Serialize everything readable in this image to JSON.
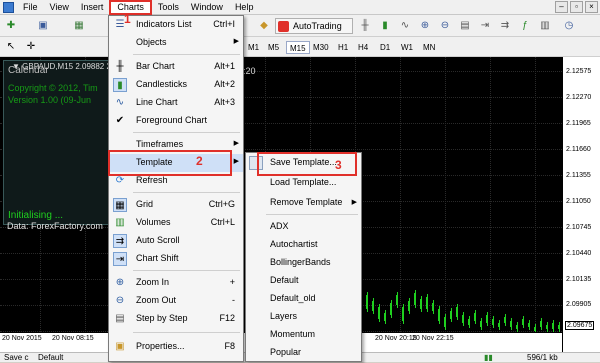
{
  "menubar": {
    "items": [
      {
        "label": "File"
      },
      {
        "label": "View"
      },
      {
        "label": "Insert"
      },
      {
        "label": "Charts"
      },
      {
        "label": "Tools"
      },
      {
        "label": "Window"
      },
      {
        "label": "Help"
      }
    ],
    "window_controls": {
      "minimize": "–",
      "restore": "▫",
      "close": "×"
    }
  },
  "toolbar": {
    "autotrading_label": "AutoTrading",
    "timeframes": [
      "M1",
      "M5",
      "M15",
      "M30",
      "H1",
      "H4",
      "D1",
      "W1",
      "MN"
    ],
    "selected_timeframe": "M15"
  },
  "chart": {
    "header": "▼ GBPAUD,M15 2.09882 2.09",
    "time_partial": "7:20",
    "indicator": {
      "title": "Calendar",
      "line1": "Copyright © 2012, Tim",
      "line2": "Version 1.00 (09-Jun",
      "status": "Initialising ...",
      "data_source": "Data: ForexFactory.com"
    },
    "prices": [
      "2.12575",
      "2.12270",
      "2.11965",
      "2.11660",
      "2.11355",
      "2.11050",
      "2.10745",
      "2.10440",
      "2.10135",
      "2.09905",
      "2.09675"
    ],
    "current_price": "2.09675",
    "time_labels": [
      "20 Nov 2015",
      "20 Nov 08:15",
      "20 Nov 20:15",
      "20 Nov 22:15"
    ]
  },
  "statusbar": {
    "left": "Save c",
    "profile": "Default",
    "traffic": "596/1 kb"
  },
  "charts_menu": {
    "items": [
      {
        "label": "Indicators List",
        "shortcut": "Ctrl+I",
        "icon": "list-icon"
      },
      {
        "label": "Objects",
        "submenu": true
      },
      {
        "label": "Bar Chart",
        "shortcut": "Alt+1",
        "icon": "bar-chart-icon"
      },
      {
        "label": "Candlesticks",
        "shortcut": "Alt+2",
        "icon": "candlestick-icon"
      },
      {
        "label": "Line Chart",
        "shortcut": "Alt+3",
        "icon": "line-chart-icon"
      },
      {
        "label": "Foreground Chart",
        "icon": "check-icon"
      },
      {
        "label": "Timeframes",
        "submenu": true
      },
      {
        "label": "Template",
        "submenu": true,
        "icon": "template-icon"
      },
      {
        "label": "Refresh",
        "icon": "refresh-icon"
      },
      {
        "label": "Grid",
        "shortcut": "Ctrl+G",
        "icon": "grid-icon"
      },
      {
        "label": "Volumes",
        "shortcut": "Ctrl+L",
        "icon": "volumes-icon"
      },
      {
        "label": "Auto Scroll",
        "icon": "autoscroll-icon"
      },
      {
        "label": "Chart Shift",
        "icon": "chart-shift-icon"
      },
      {
        "label": "Zoom In",
        "shortcut": "+",
        "icon": "zoom-in-icon"
      },
      {
        "label": "Zoom Out",
        "shortcut": "-",
        "icon": "zoom-out-icon"
      },
      {
        "label": "Step by Step",
        "shortcut": "F12",
        "icon": "step-icon"
      },
      {
        "label": "Properties...",
        "shortcut": "F8",
        "icon": "properties-icon"
      }
    ]
  },
  "template_menu": {
    "items": [
      {
        "label": "Save Template..."
      },
      {
        "label": "Load Template..."
      },
      {
        "label": "Remove Template",
        "submenu": true
      },
      {
        "label": "ADX"
      },
      {
        "label": "Autochartist"
      },
      {
        "label": "BollingerBands"
      },
      {
        "label": "Default"
      },
      {
        "label": "Default_old"
      },
      {
        "label": "Layers"
      },
      {
        "label": "Momentum"
      },
      {
        "label": "Popular"
      }
    ]
  },
  "annotations": [
    "1",
    "2",
    "3"
  ],
  "colors": {
    "highlight": "#e0302a",
    "chart_bg": "#000000",
    "candle": "#1fd01f"
  }
}
